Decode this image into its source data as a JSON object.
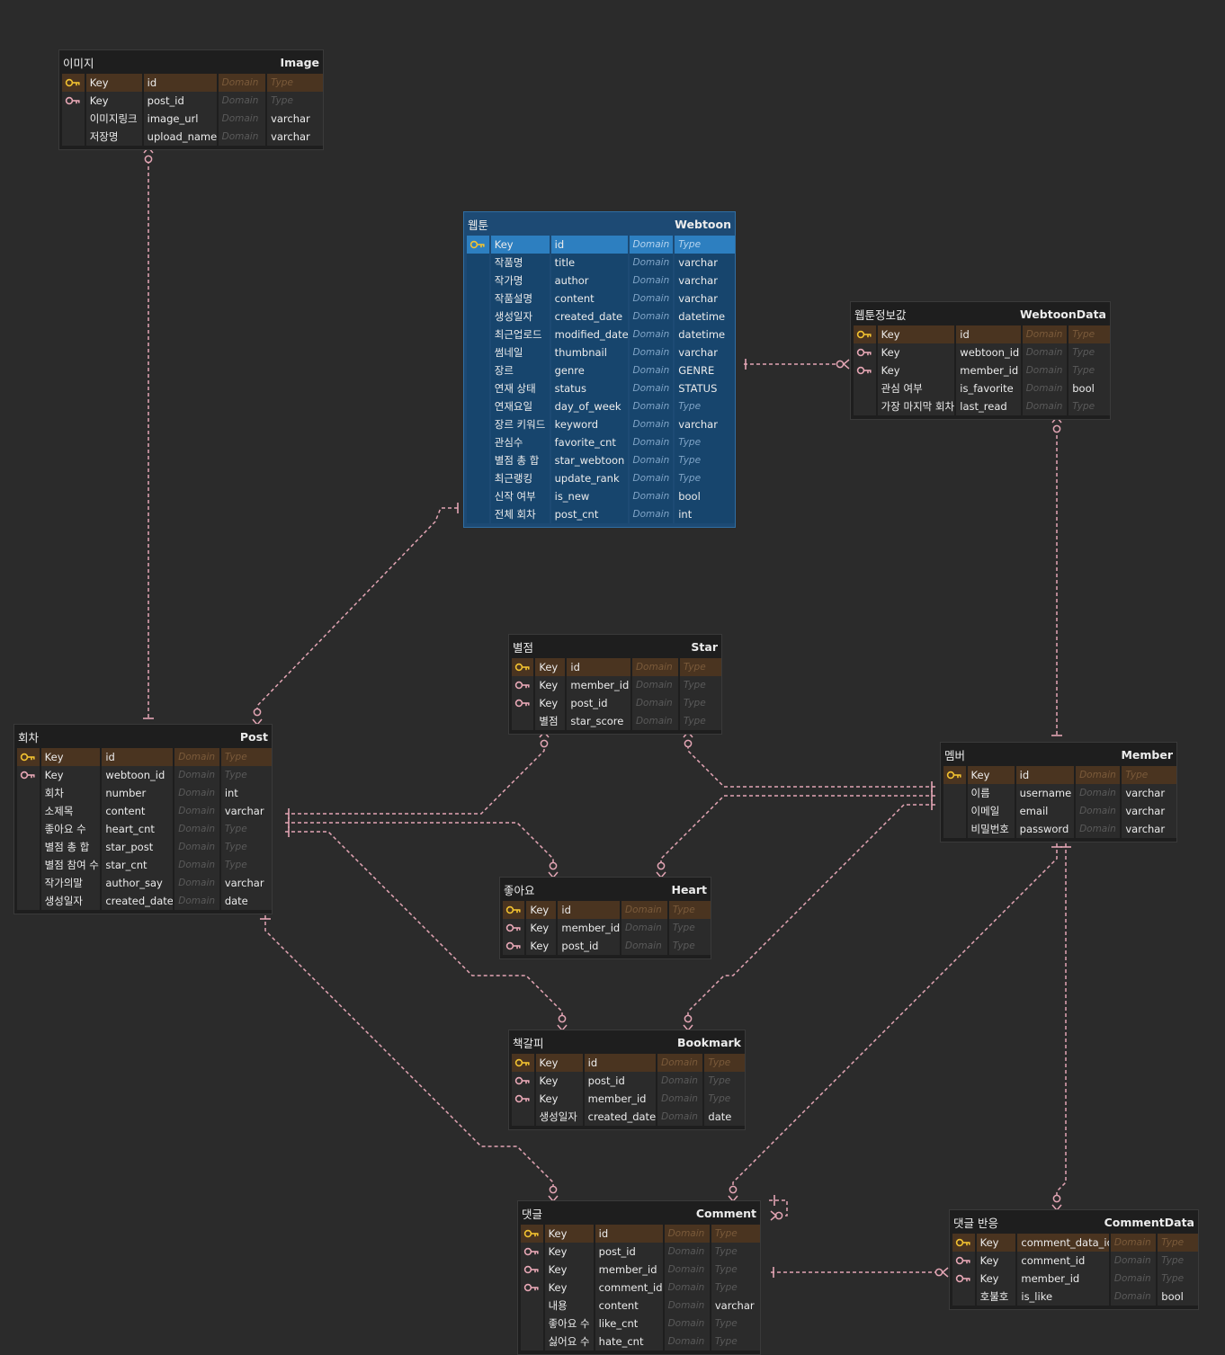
{
  "colors": {
    "canvas": "#2b2b2b",
    "entity_bg": "#1e1e1e",
    "pk_row": "#4a3420",
    "selected_bg": "#1d4a74",
    "selected_pk": "#2d7fc0",
    "relation_line": "#e3a5b4",
    "pk_icon": "#f2c230",
    "fk_icon": "#e7a7b5"
  },
  "entities": [
    {
      "id": "image",
      "logical": "이미지",
      "physical": "Image",
      "rows": [
        {
          "icon": "pk",
          "lname": "Key",
          "pname": "id",
          "domain": "Domain",
          "type": "Type"
        },
        {
          "icon": "fk",
          "lname": "Key",
          "pname": "post_id",
          "domain": "Domain",
          "type": "Type"
        },
        {
          "icon": "",
          "lname": "이미지링크",
          "pname": "image_url",
          "domain": "Domain",
          "type": "varchar"
        },
        {
          "icon": "",
          "lname": "저장명",
          "pname": "upload_name",
          "domain": "Domain",
          "type": "varchar"
        }
      ]
    },
    {
      "id": "webtoon",
      "logical": "웹툰",
      "physical": "Webtoon",
      "selected": true,
      "rows": [
        {
          "icon": "pk",
          "lname": "Key",
          "pname": "id",
          "domain": "Domain",
          "type": "Type"
        },
        {
          "icon": "",
          "lname": "작품명",
          "pname": "title",
          "domain": "Domain",
          "type": "varchar"
        },
        {
          "icon": "",
          "lname": "작가명",
          "pname": "author",
          "domain": "Domain",
          "type": "varchar"
        },
        {
          "icon": "",
          "lname": "작품설명",
          "pname": "content",
          "domain": "Domain",
          "type": "varchar"
        },
        {
          "icon": "",
          "lname": "생성일자",
          "pname": "created_date",
          "domain": "Domain",
          "type": "datetime"
        },
        {
          "icon": "",
          "lname": "최근업로드",
          "pname": "modified_date",
          "domain": "Domain",
          "type": "datetime"
        },
        {
          "icon": "",
          "lname": "썸네일",
          "pname": "thumbnail",
          "domain": "Domain",
          "type": "varchar"
        },
        {
          "icon": "",
          "lname": "장르",
          "pname": "genre",
          "domain": "Domain",
          "type": "GENRE"
        },
        {
          "icon": "",
          "lname": "연재 상태",
          "pname": "status",
          "domain": "Domain",
          "type": "STATUS"
        },
        {
          "icon": "",
          "lname": "연재요일",
          "pname": "day_of_week",
          "domain": "Domain",
          "type": "Type"
        },
        {
          "icon": "",
          "lname": "장르 키워드",
          "pname": "keyword",
          "domain": "Domain",
          "type": "varchar"
        },
        {
          "icon": "",
          "lname": "관심수",
          "pname": "favorite_cnt",
          "domain": "Domain",
          "type": "Type"
        },
        {
          "icon": "",
          "lname": "별점 총 합",
          "pname": "star_webtoon",
          "domain": "Domain",
          "type": "Type"
        },
        {
          "icon": "",
          "lname": "최근랭킹",
          "pname": "update_rank",
          "domain": "Domain",
          "type": "Type"
        },
        {
          "icon": "",
          "lname": "신작 여부",
          "pname": "is_new",
          "domain": "Domain",
          "type": "bool"
        },
        {
          "icon": "",
          "lname": "전체 회차",
          "pname": "post_cnt",
          "domain": "Domain",
          "type": "int"
        }
      ]
    },
    {
      "id": "webtoondata",
      "logical": "웹툰정보값",
      "physical": "WebtoonData",
      "rows": [
        {
          "icon": "pk",
          "lname": "Key",
          "pname": "id",
          "domain": "Domain",
          "type": "Type"
        },
        {
          "icon": "fk",
          "lname": "Key",
          "pname": "webtoon_id",
          "domain": "Domain",
          "type": "Type"
        },
        {
          "icon": "fk",
          "lname": "Key",
          "pname": "member_id",
          "domain": "Domain",
          "type": "Type"
        },
        {
          "icon": "",
          "lname": "관심 여부",
          "pname": "is_favorite",
          "domain": "Domain",
          "type": "bool"
        },
        {
          "icon": "",
          "lname": "가장 마지막 회차",
          "pname": "last_read",
          "domain": "Domain",
          "type": "Type"
        }
      ]
    },
    {
      "id": "star",
      "logical": "별점",
      "physical": "Star",
      "rows": [
        {
          "icon": "pk",
          "lname": "Key",
          "pname": "id",
          "domain": "Domain",
          "type": "Type"
        },
        {
          "icon": "fk",
          "lname": "Key",
          "pname": "member_id",
          "domain": "Domain",
          "type": "Type"
        },
        {
          "icon": "fk",
          "lname": "Key",
          "pname": "post_id",
          "domain": "Domain",
          "type": "Type"
        },
        {
          "icon": "",
          "lname": "별점",
          "pname": "star_score",
          "domain": "Domain",
          "type": "Type"
        }
      ]
    },
    {
      "id": "post",
      "logical": "회차",
      "physical": "Post",
      "rows": [
        {
          "icon": "pk",
          "lname": "Key",
          "pname": "id",
          "domain": "Domain",
          "type": "Type"
        },
        {
          "icon": "fk",
          "lname": "Key",
          "pname": "webtoon_id",
          "domain": "Domain",
          "type": "Type"
        },
        {
          "icon": "",
          "lname": "회차",
          "pname": "number",
          "domain": "Domain",
          "type": "int"
        },
        {
          "icon": "",
          "lname": "소제목",
          "pname": "content",
          "domain": "Domain",
          "type": "varchar"
        },
        {
          "icon": "",
          "lname": "좋아요 수",
          "pname": "heart_cnt",
          "domain": "Domain",
          "type": "Type"
        },
        {
          "icon": "",
          "lname": "별점 총 합",
          "pname": "star_post",
          "domain": "Domain",
          "type": "Type"
        },
        {
          "icon": "",
          "lname": "별점 참여 수",
          "pname": "star_cnt",
          "domain": "Domain",
          "type": "Type"
        },
        {
          "icon": "",
          "lname": "작가의말",
          "pname": "author_say",
          "domain": "Domain",
          "type": "varchar"
        },
        {
          "icon": "",
          "lname": "생성일자",
          "pname": "created_date",
          "domain": "Domain",
          "type": "date"
        }
      ]
    },
    {
      "id": "member",
      "logical": "멤버",
      "physical": "Member",
      "rows": [
        {
          "icon": "pk",
          "lname": "Key",
          "pname": "id",
          "domain": "Domain",
          "type": "Type"
        },
        {
          "icon": "",
          "lname": "이름",
          "pname": "username",
          "domain": "Domain",
          "type": "varchar"
        },
        {
          "icon": "",
          "lname": "이메일",
          "pname": "email",
          "domain": "Domain",
          "type": "varchar"
        },
        {
          "icon": "",
          "lname": "비밀번호",
          "pname": "password",
          "domain": "Domain",
          "type": "varchar"
        }
      ]
    },
    {
      "id": "heart",
      "logical": "좋아요",
      "physical": "Heart",
      "rows": [
        {
          "icon": "pk",
          "lname": "Key",
          "pname": "id",
          "domain": "Domain",
          "type": "Type"
        },
        {
          "icon": "fk",
          "lname": "Key",
          "pname": "member_id",
          "domain": "Domain",
          "type": "Type"
        },
        {
          "icon": "fk",
          "lname": "Key",
          "pname": "post_id",
          "domain": "Domain",
          "type": "Type"
        }
      ]
    },
    {
      "id": "bookmark",
      "logical": "책갈피",
      "physical": "Bookmark",
      "rows": [
        {
          "icon": "pk",
          "lname": "Key",
          "pname": "id",
          "domain": "Domain",
          "type": "Type"
        },
        {
          "icon": "fk",
          "lname": "Key",
          "pname": "post_id",
          "domain": "Domain",
          "type": "Type"
        },
        {
          "icon": "fk",
          "lname": "Key",
          "pname": "member_id",
          "domain": "Domain",
          "type": "Type"
        },
        {
          "icon": "",
          "lname": "생성일자",
          "pname": "created_date",
          "domain": "Domain",
          "type": "date"
        }
      ]
    },
    {
      "id": "comment",
      "logical": "댓글",
      "physical": "Comment",
      "rows": [
        {
          "icon": "pk",
          "lname": "Key",
          "pname": "id",
          "domain": "Domain",
          "type": "Type"
        },
        {
          "icon": "fk",
          "lname": "Key",
          "pname": "post_id",
          "domain": "Domain",
          "type": "Type"
        },
        {
          "icon": "fk",
          "lname": "Key",
          "pname": "member_id",
          "domain": "Domain",
          "type": "Type"
        },
        {
          "icon": "fk",
          "lname": "Key",
          "pname": "comment_id",
          "domain": "Domain",
          "type": "Type"
        },
        {
          "icon": "",
          "lname": "내용",
          "pname": "content",
          "domain": "Domain",
          "type": "varchar"
        },
        {
          "icon": "",
          "lname": "좋아요 수",
          "pname": "like_cnt",
          "domain": "Domain",
          "type": "Type"
        },
        {
          "icon": "",
          "lname": "싫어요 수",
          "pname": "hate_cnt",
          "domain": "Domain",
          "type": "Type"
        }
      ]
    },
    {
      "id": "commentdata",
      "logical": "댓글 반응",
      "physical": "CommentData",
      "rows": [
        {
          "icon": "pk",
          "lname": "Key",
          "pname": "comment_data_id",
          "domain": "Domain",
          "type": "Type"
        },
        {
          "icon": "fk",
          "lname": "Key",
          "pname": "comment_id",
          "domain": "Domain",
          "type": "Type"
        },
        {
          "icon": "fk",
          "lname": "Key",
          "pname": "member_id",
          "domain": "Domain",
          "type": "Type"
        },
        {
          "icon": "",
          "lname": "호불호",
          "pname": "is_like",
          "domain": "Domain",
          "type": "bool"
        }
      ]
    }
  ],
  "relations": [
    {
      "from": "post",
      "to": "image",
      "from_card": "one",
      "to_card": "zero-many"
    },
    {
      "from": "webtoon",
      "to": "post",
      "from_card": "one",
      "to_card": "zero-many"
    },
    {
      "from": "webtoon",
      "to": "webtoondata",
      "from_card": "one",
      "to_card": "zero-many"
    },
    {
      "from": "member",
      "to": "webtoondata",
      "from_card": "one",
      "to_card": "zero-many"
    },
    {
      "from": "post",
      "to": "star",
      "from_card": "one",
      "to_card": "zero-many"
    },
    {
      "from": "member",
      "to": "star",
      "from_card": "one",
      "to_card": "zero-many"
    },
    {
      "from": "post",
      "to": "heart",
      "from_card": "one",
      "to_card": "zero-many"
    },
    {
      "from": "member",
      "to": "heart",
      "from_card": "one",
      "to_card": "zero-many"
    },
    {
      "from": "post",
      "to": "bookmark",
      "from_card": "one",
      "to_card": "zero-many"
    },
    {
      "from": "member",
      "to": "bookmark",
      "from_card": "one",
      "to_card": "zero-many"
    },
    {
      "from": "post",
      "to": "comment",
      "from_card": "one",
      "to_card": "zero-many"
    },
    {
      "from": "member",
      "to": "comment",
      "from_card": "one",
      "to_card": "zero-many"
    },
    {
      "from": "member",
      "to": "commentdata",
      "from_card": "one",
      "to_card": "zero-many"
    },
    {
      "from": "comment",
      "to": "commentdata",
      "from_card": "one",
      "to_card": "zero-many"
    },
    {
      "from": "comment",
      "to": "comment",
      "from_card": "one",
      "to_card": "zero-many"
    }
  ]
}
